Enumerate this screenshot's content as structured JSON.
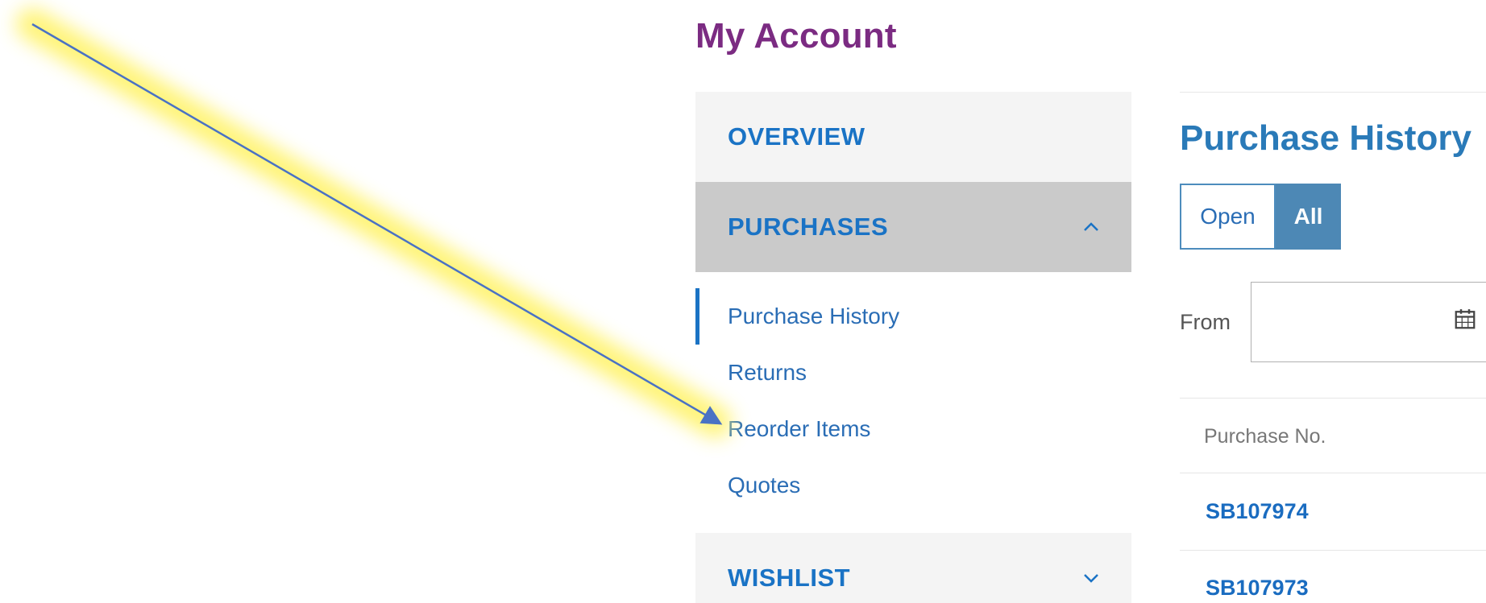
{
  "account": {
    "title": "My Account"
  },
  "sidebar": {
    "sections": [
      {
        "label": "OVERVIEW"
      },
      {
        "label": "PURCHASES",
        "expanded": true,
        "items": [
          {
            "label": "Purchase History",
            "current": true
          },
          {
            "label": "Returns"
          },
          {
            "label": "Reorder Items"
          },
          {
            "label": "Quotes"
          }
        ]
      },
      {
        "label": "WISHLIST",
        "expanded": false
      }
    ]
  },
  "main": {
    "title": "Purchase History",
    "filter_toggle": {
      "open_label": "Open",
      "all_label": "All",
      "selected": "All"
    },
    "date_filter": {
      "from_label": "From",
      "from_value": ""
    },
    "table": {
      "column_header": "Purchase No.",
      "rows": [
        {
          "purchase_no": "SB107974"
        },
        {
          "purchase_no": "SB107973"
        }
      ]
    }
  },
  "colors": {
    "account_title": "#7b2b82",
    "link_blue": "#1a73c5",
    "active_section_bg": "#cacaca",
    "section_bg": "#f4f4f4",
    "toggle_selected_bg": "#4d88b5",
    "annotation_arrow": "#4a72c4",
    "annotation_highlight": "#fff36b"
  },
  "icons": {
    "purchases_chevron": "chevron-up-icon",
    "wishlist_chevron": "chevron-down-icon",
    "date_picker": "calendar-icon"
  }
}
